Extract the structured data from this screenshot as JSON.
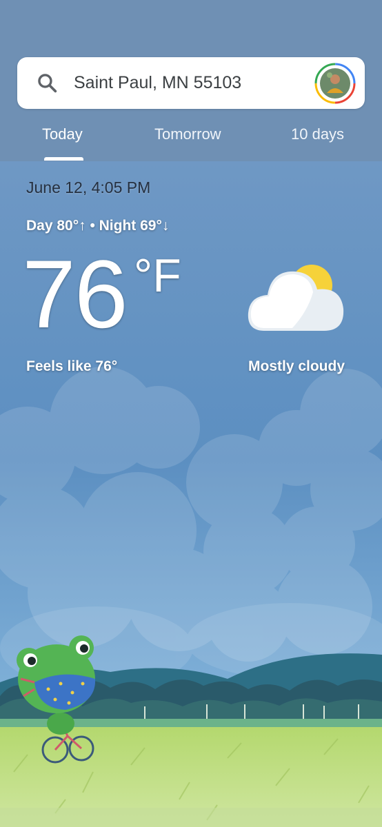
{
  "search": {
    "location": "Saint Paul, MN 55103"
  },
  "tabs": [
    {
      "label": "Today",
      "selected": true
    },
    {
      "label": "Tomorrow",
      "selected": false
    },
    {
      "label": "10 days",
      "selected": false
    }
  ],
  "weather": {
    "date_time": "June 12, 4:05 PM",
    "day_night": "Day 80°↑ • Night 69°↓",
    "temperature": "76",
    "unit": "°F",
    "feels_like": "Feels like 76°",
    "condition": "Mostly cloudy",
    "condition_icon": "partly-cloudy-icon"
  },
  "colors": {
    "header": "#6f90b4",
    "sky_top": "#7ba3cb",
    "grass": "#c7e08a",
    "sun": "#f6d23a"
  }
}
